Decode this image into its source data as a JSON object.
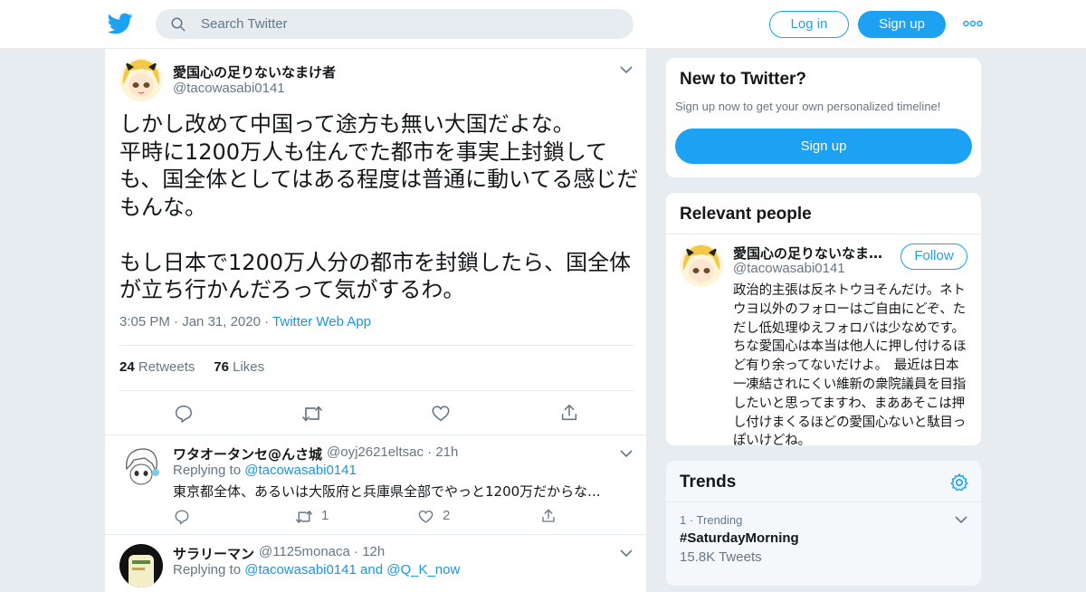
{
  "header": {
    "search_placeholder": "Search Twitter",
    "login_label": "Log in",
    "signup_label": "Sign up",
    "logo_icon": "twitter-bird-icon",
    "more_icon": "more-dots-icon"
  },
  "tweet": {
    "name": "愛国心の足りないなまけ者",
    "handle": "@tacowasabi0141",
    "text": "しかし改めて中国って途方も無い大国だよな。\n平時に1200万人も住んでた都市を事実上封鎖しても、国全体としてはある程度は普通に動いてる感じだもんな。\n\nもし日本で1200万人分の都市を封鎖したら、国全体が立ち行かんだろって気がするわ。",
    "time": "3:05 PM",
    "date": "Jan 31, 2020",
    "source": "Twitter Web App",
    "retweets_count": "24",
    "retweets_label": "Retweets",
    "likes_count": "76",
    "likes_label": "Likes"
  },
  "replies": [
    {
      "name": "ワタオータンセ@んさ城",
      "handle": "@oyj2621eltsac",
      "age": "21h",
      "replying_prefix": "Replying to",
      "replying_to": "@tacowasabi0141",
      "text": "東京都全体、あるいは大阪府と兵庫県全部でやっと1200万だからな...",
      "retweets": "1",
      "likes": "2"
    },
    {
      "name": "サラリーマン",
      "handle": "@1125monaca",
      "age": "12h",
      "replying_prefix": "Replying to",
      "replying_to": "@tacowasabi0141 and @Q_K_now"
    }
  ],
  "sidebar": {
    "new_title": "New to Twitter?",
    "new_sub": "Sign up now to get your own personalized timeline!",
    "new_signup": "Sign up",
    "relevant_title": "Relevant people",
    "person_name": "愛国心の足りないなま…",
    "person_handle": "@tacowasabi0141",
    "follow_label": "Follow",
    "bio": "政治的主張は反ネトウヨそんだけ。ネトウヨ以外のフォローはご自由にどぞ、ただし低処理ゆえフォロバは少なめです。　ちな愛国心は本当は他人に押し付けるほど有り余ってないだけよ。　最近は日本一凍結されにくい維新の衆院議員を目指したいと思ってますわ、まああそこは押し付けまくるほどの愛国心ないと駄目っぽいけどね。",
    "trends_title": "Trends",
    "trend_rank": "1 · Trending",
    "trend_name": "#SaturdayMorning",
    "trend_count": "15.8K Tweets"
  },
  "colors": {
    "accent": "#1da1f2",
    "link": "#1b95e0",
    "muted": "#657786"
  }
}
